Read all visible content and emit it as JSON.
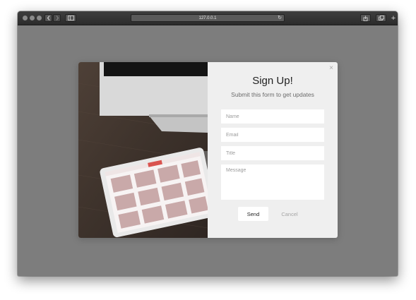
{
  "browser": {
    "address": "127.0.0.1",
    "reload_icon": "reload-icon"
  },
  "modal": {
    "title": "Sign Up!",
    "subtitle": "Submit this form to get updates",
    "close_glyph": "×",
    "fields": {
      "name_placeholder": "Name",
      "email_placeholder": "Email",
      "title_placeholder": "Title",
      "message_placeholder": "Message"
    },
    "send_label": "Send",
    "cancel_label": "Cancel"
  },
  "colors": {
    "backdrop": "#7d7d7d",
    "modal_bg": "#efefef",
    "accent_red": "#d9534f"
  }
}
